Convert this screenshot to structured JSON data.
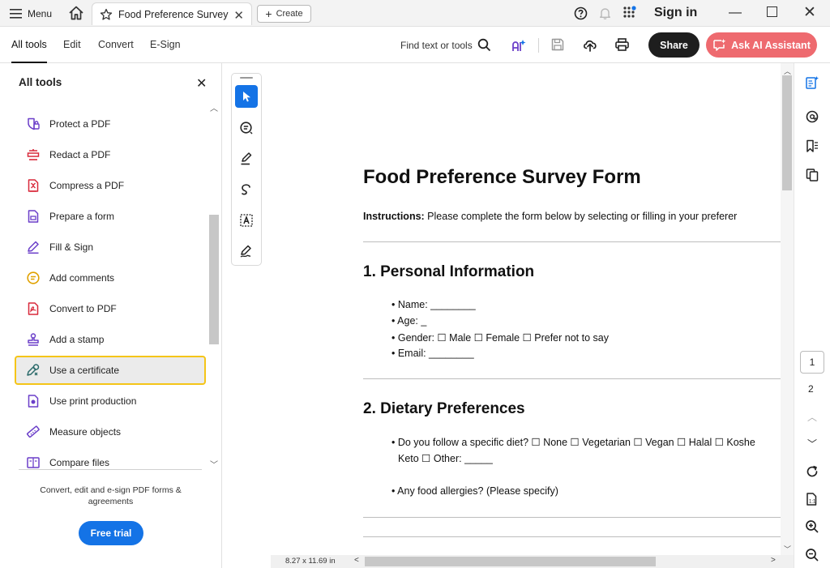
{
  "titlebar": {
    "menu_label": "Menu",
    "tab_title": "Food Preference Survey ...",
    "create_label": "Create",
    "signin_label": "Sign in"
  },
  "toolbar": {
    "tabs": [
      "All tools",
      "Edit",
      "Convert",
      "E-Sign"
    ],
    "find_label": "Find text or tools",
    "share_label": "Share",
    "ai_label": "Ask AI Assistant"
  },
  "panel": {
    "title": "All tools",
    "items": [
      {
        "label": "Protect a PDF",
        "icon": "shield-icon"
      },
      {
        "label": "Redact a PDF",
        "icon": "redact-icon"
      },
      {
        "label": "Compress a PDF",
        "icon": "compress-icon"
      },
      {
        "label": "Prepare a form",
        "icon": "form-icon"
      },
      {
        "label": "Fill & Sign",
        "icon": "pen-icon"
      },
      {
        "label": "Add comments",
        "icon": "comment-icon"
      },
      {
        "label": "Convert to PDF",
        "icon": "convert-icon"
      },
      {
        "label": "Add a stamp",
        "icon": "stamp-icon"
      },
      {
        "label": "Use a certificate",
        "icon": "certificate-icon",
        "selected": true
      },
      {
        "label": "Use print production",
        "icon": "print-production-icon"
      },
      {
        "label": "Measure objects",
        "icon": "ruler-icon"
      },
      {
        "label": "Compare files",
        "icon": "compare-icon"
      }
    ],
    "promo_text": "Convert, edit and e-sign PDF forms & agreements",
    "trial_label": "Free trial"
  },
  "document": {
    "title": "Food Preference Survey Form",
    "instructions_label": "Instructions:",
    "instructions_text": " Please complete the form below by selecting or filling in your preferer",
    "section1_heading": "1. Personal Information",
    "section1_items": [
      "• Name: ________",
      "• Age: _",
      "• Gender: ☐ Male ☐ Female ☐ Prefer not to say",
      "• Email: ________"
    ],
    "section2_heading": "2. Dietary Preferences",
    "section2_items": [
      "• Do you follow a specific diet? ☐ None ☐ Vegetarian ☐ Vegan ☐ Halal ☐ Koshe",
      "Keto ☐ Other: _____",
      "• Any food allergies? (Please specify)"
    ]
  },
  "status": {
    "page_size": "8.27 x 11.69 in",
    "current_page": "1",
    "total_pages": "2"
  },
  "colors": {
    "accent_blue": "#1473e6",
    "ai_button": "#ee6a6f",
    "selected_outline": "#f5c518",
    "tool_icon_purple": "#6b3fc9",
    "tool_icon_red": "#d8283a"
  }
}
